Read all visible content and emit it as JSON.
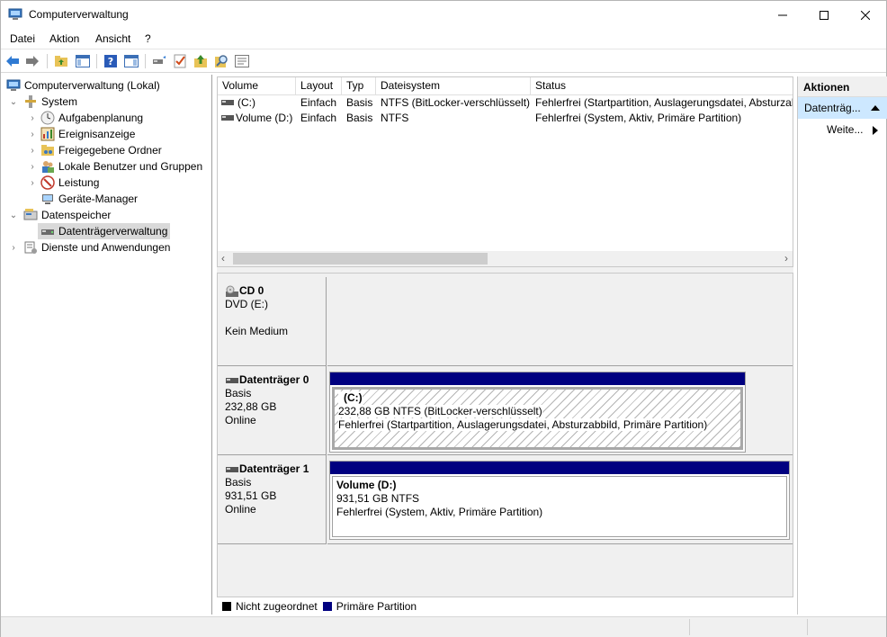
{
  "window": {
    "title": "Computerverwaltung"
  },
  "menu": [
    "Datei",
    "Aktion",
    "Ansicht",
    "?"
  ],
  "toolbar": {
    "buttons": [
      "back-icon",
      "forward-icon",
      "up-folder-icon",
      "show-hide-tree-icon",
      "help-icon",
      "show-action-pane-icon",
      "connect-icon",
      "checklist-icon",
      "export-icon",
      "search-icon",
      "properties-icon"
    ]
  },
  "tree": {
    "root": "Computerverwaltung (Lokal)",
    "system": "System",
    "system_items": [
      "Aufgabenplanung",
      "Ereignisanzeige",
      "Freigegebene Ordner",
      "Lokale Benutzer und Gruppen",
      "Leistung",
      "Geräte-Manager"
    ],
    "storage": "Datenspeicher",
    "storage_items": [
      "Datenträgerverwaltung"
    ],
    "services": "Dienste und Anwendungen"
  },
  "volume_list": {
    "columns": [
      "Volume",
      "Layout",
      "Typ",
      "Dateisystem",
      "Status"
    ],
    "rows": [
      {
        "volume": "(C:)",
        "layout": "Einfach",
        "typ": "Basis",
        "dateisystem": "NTFS (BitLocker-verschlüsselt)",
        "status": "Fehlerfrei (Startpartition, Auslagerungsdatei, Absturzab"
      },
      {
        "volume": "Volume (D:)",
        "layout": "Einfach",
        "typ": "Basis",
        "dateisystem": "NTFS",
        "status": "Fehlerfrei (System, Aktiv, Primäre Partition)"
      }
    ]
  },
  "disks": {
    "cd0": {
      "name": "CD 0",
      "line1": "DVD (E:)",
      "line2": "Kein Medium"
    },
    "disk0": {
      "name": "Datenträger 0",
      "type": "Basis",
      "size": "232,88 GB",
      "state": "Online",
      "partition": {
        "title": "(C:)",
        "size_fs": "232,88 GB NTFS (BitLocker-verschlüsselt)",
        "status": "Fehlerfrei (Startpartition, Auslagerungsdatei, Absturzabbild, Primäre Partition)"
      }
    },
    "disk1": {
      "name": "Datenträger 1",
      "type": "Basis",
      "size": "931,51 GB",
      "state": "Online",
      "partition": {
        "title": "Volume  (D:)",
        "size_fs": "931,51 GB NTFS",
        "status": "Fehlerfrei (System, Aktiv, Primäre Partition)"
      }
    }
  },
  "legend": {
    "unallocated": "Nicht zugeordnet",
    "primary": "Primäre Partition"
  },
  "colors": {
    "unallocated": "#000000",
    "primary": "#000080",
    "selection": "#cde8ff"
  },
  "actions": {
    "header": "Aktionen",
    "section": "Datenträg...",
    "more": "Weite..."
  }
}
